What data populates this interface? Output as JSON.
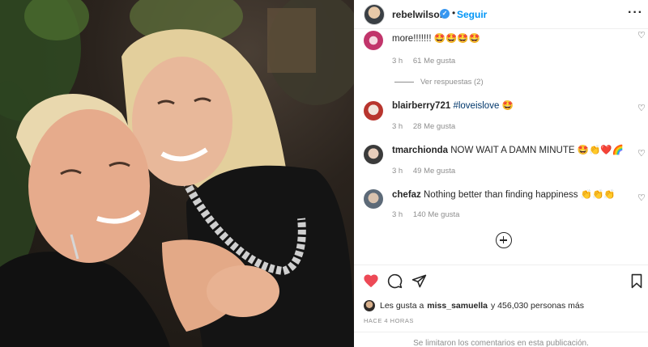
{
  "header": {
    "username": "rebelwilson",
    "verified_icon": "verified-badge-icon",
    "separator": "•",
    "follow_label": "Seguir",
    "more_label": "···"
  },
  "comments": [
    {
      "user": "",
      "text": "",
      "text_line2": "more!!!!!!! 🤩🤩🤩🤩",
      "time": "3 h",
      "likes": "61 Me gusta",
      "replies_label": "Ver respuestas (2)"
    },
    {
      "user": "blairberry721",
      "text_tag": "#loveislove",
      "text_emoji": "🤩",
      "time": "3 h",
      "likes": "28 Me gusta"
    },
    {
      "user": "tmarchionda",
      "text": "NOW WAIT A DAMN MINUTE 🤩👏❤️🌈",
      "time": "3 h",
      "likes": "49 Me gusta"
    },
    {
      "user": "chefaz",
      "text": "Nothing better than finding happiness 👏👏👏",
      "time": "3 h",
      "likes": "140 Me gusta"
    }
  ],
  "likes": {
    "prefix": "Les gusta a",
    "user": "miss_samuella",
    "suffix": "y 456,030 personas más"
  },
  "timestamp": "HACE 4 HORAS",
  "footer": "Se limitaron los comentarios en esta publicación.",
  "icons": {
    "like": "heart-filled-icon",
    "comment": "comment-icon",
    "share": "paper-plane-icon",
    "save": "bookmark-icon",
    "load_more": "plus-circle-icon"
  },
  "colors": {
    "link": "#0095f6",
    "like": "#ed4956",
    "muted": "#8e8e8e"
  }
}
